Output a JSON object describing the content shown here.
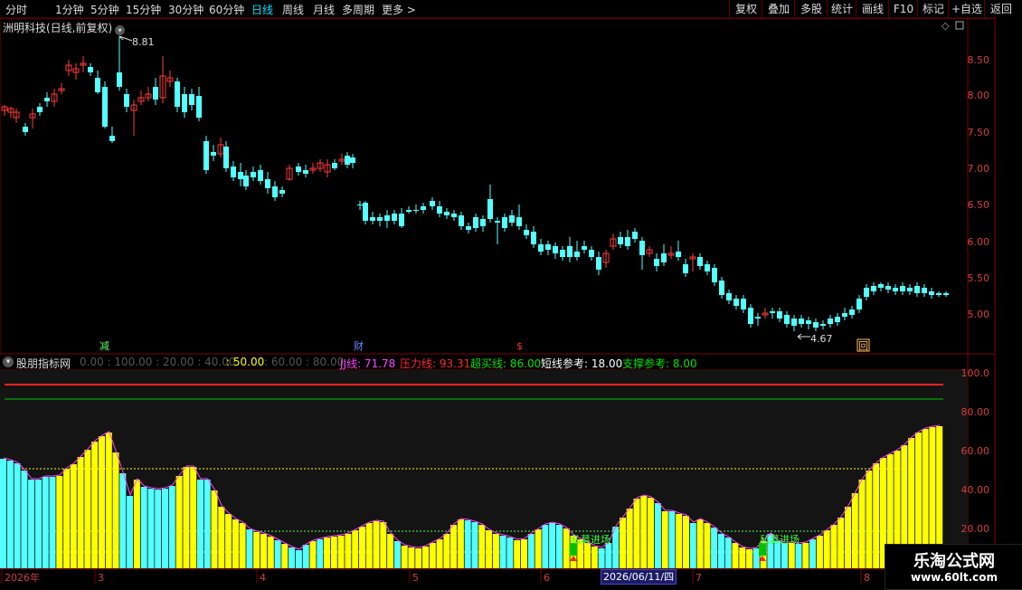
{
  "toolbar": {
    "periods": [
      "分时",
      "1分钟",
      "5分钟",
      "15分钟",
      "30分钟",
      "60分钟",
      "日线",
      "周线",
      "月线",
      "多周期",
      "更多 >"
    ],
    "active_index": 6,
    "right_buttons": [
      "复权",
      "叠加",
      "多股",
      "统计",
      "画线",
      "F10",
      "标记",
      "+自选",
      "返回"
    ]
  },
  "chart": {
    "title": "洲明科技(日线,前复权)",
    "high_label": "8.81",
    "low_label": "4.67",
    "price_axis": [
      "8.50",
      "8.00",
      "7.50",
      "7.00",
      "6.50",
      "6.00",
      "5.50",
      "5.00"
    ],
    "event_markers": [
      "减",
      "财",
      "$",
      "回"
    ],
    "colors": {
      "up": "#ff3c3c",
      "down": "#54ffff"
    }
  },
  "indicator": {
    "name": "股朋指标网",
    "faded_ticks": "0.00 : 100.00 : 20.00 : 40.00",
    "highlight_tick": ": 50.00",
    "faded_ticks2": ": 60.00 : 80.00",
    "jj": "JJ线: 71.78",
    "pressure": "压力线: 93.31",
    "overbought": "超买线: 86.00",
    "short_ref": "短线参考: 18.00",
    "support_ref": "支撑参考: 8.00",
    "axis": [
      "100.0",
      "80.00",
      "60.00",
      "40.00",
      "20.00"
    ],
    "signal_label": "私募进场",
    "colors": {
      "pressure": "#ff2020",
      "overbought": "#00c800",
      "bar_yellow": "#ffff00",
      "bar_cyan": "#54ffff"
    }
  },
  "date_axis": {
    "labels": [
      "2026年",
      "3",
      "4",
      "5",
      "6",
      "7",
      "8"
    ],
    "cursor_date": "2026/06/11/四"
  },
  "watermark": {
    "title": "乐淘公式网",
    "url": "www.60lt.com"
  }
}
